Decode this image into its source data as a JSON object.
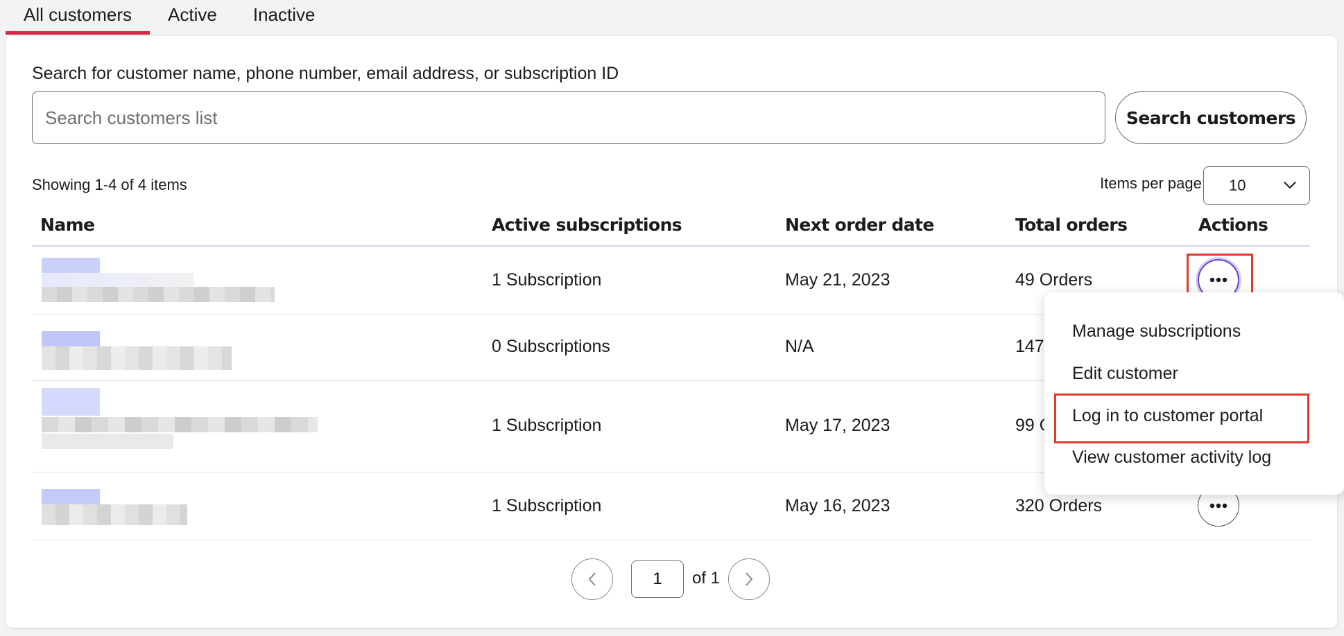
{
  "tabs": [
    {
      "label": "All customers",
      "selected": true
    },
    {
      "label": "Active",
      "selected": false
    },
    {
      "label": "Inactive",
      "selected": false
    }
  ],
  "search": {
    "label": "Search for customer name, phone number, email address, or subscription ID",
    "placeholder": "Search customers list",
    "value": "",
    "button_label": "Search customers"
  },
  "results": {
    "showing": "Showing 1-4 of 4 items",
    "items_per_page_label": "Items per page:",
    "items_per_page_value": "10"
  },
  "table": {
    "headers": [
      "Name",
      "Active subscriptions",
      "Next order date",
      "Total orders",
      "Actions"
    ],
    "rows": [
      {
        "name": "",
        "subscriptions": "1 Subscription",
        "next_order": "May 21, 2023",
        "total_orders": "49 Orders"
      },
      {
        "name": "",
        "subscriptions": "0 Subscriptions",
        "next_order": "N/A",
        "total_orders": "147"
      },
      {
        "name": "",
        "subscriptions": "1 Subscription",
        "next_order": "May 17, 2023",
        "total_orders": "99 O"
      },
      {
        "name": "",
        "subscriptions": "1 Subscription",
        "next_order": "May 16, 2023",
        "total_orders": "320 Orders"
      }
    ]
  },
  "actions_menu": {
    "items": [
      "Manage subscriptions",
      "Edit customer",
      "Log in to customer portal",
      "View customer activity log"
    ],
    "highlighted_item": "Log in to customer portal"
  },
  "pagination": {
    "current_page": "1",
    "of_label": "of 1"
  },
  "colors": {
    "tab_underline": "#d42a48",
    "highlight": "#e03a2b",
    "active_ring": "#6a3fd0"
  },
  "icons": [
    "chevron-down-icon",
    "more-dots-icon",
    "chevron-left-icon",
    "chevron-right-icon"
  ]
}
